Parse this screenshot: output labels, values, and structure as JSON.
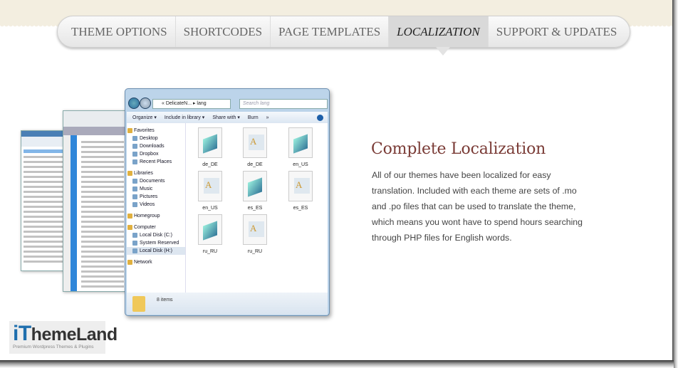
{
  "nav": {
    "tabs": [
      {
        "label": "THEME OPTIONS"
      },
      {
        "label": "SHORTCODES"
      },
      {
        "label": "PAGE TEMPLATES"
      },
      {
        "label": "LOCALIZATION",
        "active": true
      },
      {
        "label": "SUPPORT & UPDATES"
      }
    ]
  },
  "explorer": {
    "address": "« DelicateN... ▸ lang",
    "search_placeholder": "Search lang",
    "toolbar": [
      "Organize ▾",
      "Include in library ▾",
      "Share with ▾",
      "Burn",
      "»"
    ],
    "sidebar": [
      {
        "label": "Favorites",
        "header": true
      },
      {
        "label": "Desktop"
      },
      {
        "label": "Downloads"
      },
      {
        "label": "Dropbox"
      },
      {
        "label": "Recent Places"
      },
      {
        "label": "Libraries",
        "header": true
      },
      {
        "label": "Documents"
      },
      {
        "label": "Music"
      },
      {
        "label": "Pictures"
      },
      {
        "label": "Videos"
      },
      {
        "label": "Homegroup",
        "header": true
      },
      {
        "label": "Computer",
        "header": true
      },
      {
        "label": "Local Disk (C:)"
      },
      {
        "label": "System Reserved (E:)"
      },
      {
        "label": "Local Disk (H:)",
        "selected": true
      },
      {
        "label": "Network",
        "header": true
      }
    ],
    "files": [
      {
        "name": "de_DE",
        "type": "po"
      },
      {
        "name": "de_DE",
        "type": "mo"
      },
      {
        "name": "en_US",
        "type": "po"
      },
      {
        "name": "en_US",
        "type": "mo"
      },
      {
        "name": "es_ES",
        "type": "po"
      },
      {
        "name": "es_ES",
        "type": "mo"
      },
      {
        "name": "ru_RU",
        "type": "po"
      },
      {
        "name": "ru_RU",
        "type": "mo"
      }
    ],
    "status": "8 items"
  },
  "content": {
    "title": "Complete Localization",
    "description": "All of our themes have been localized for easy translation. Included with each theme are sets of .mo and .po files that can be used to translate the theme, which means you wont have to spend hours searching through PHP files for English words."
  },
  "logo": {
    "text": "iThemeLand",
    "tagline": "Premium Wordpress Themes & Plugins"
  },
  "colors": {
    "title": "#7a3b36",
    "logo_blue": "#1f6fae"
  }
}
